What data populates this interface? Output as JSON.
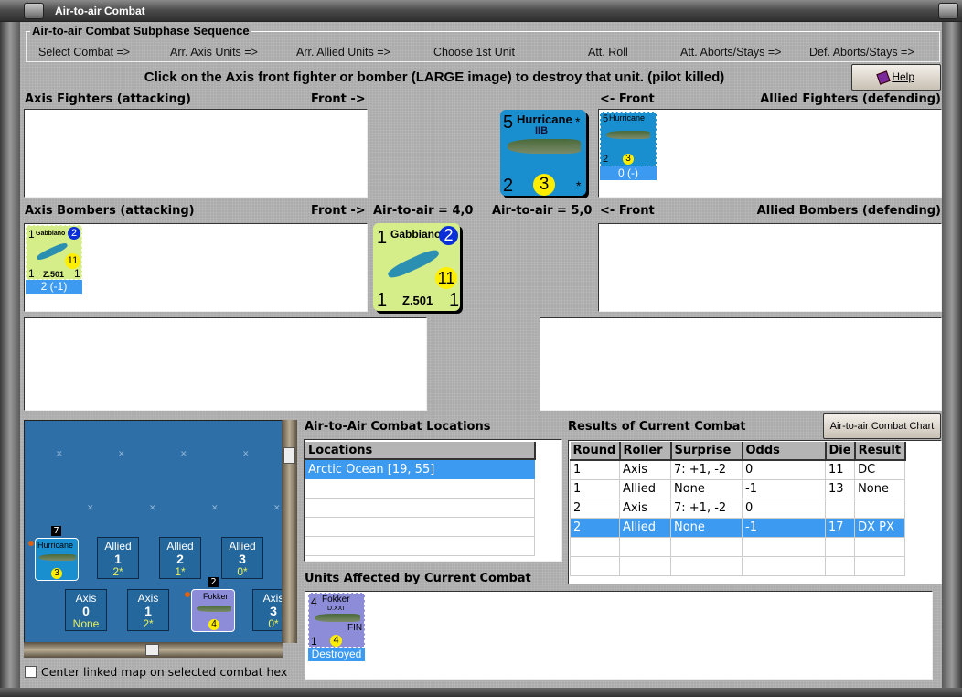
{
  "window": {
    "title": "Air-to-air Combat"
  },
  "subphase": {
    "title": "Air-to-air Combat Subphase Sequence",
    "steps": [
      "Select Combat =>",
      "Arr. Axis Units =>",
      "Arr. Allied Units =>",
      "Choose 1st Unit",
      "Att. Roll",
      "Att. Aborts/Stays =>",
      "Def. Aborts/Stays =>"
    ]
  },
  "instruction": "Click on the Axis front fighter or bomber (LARGE image) to destroy that unit. (pilot killed)",
  "help_label": "Help",
  "labels": {
    "axis_fighters": "Axis Fighters (attacking)",
    "front_right": "Front ->",
    "front_left": "<- Front",
    "allied_fighters": "Allied Fighters (defending)",
    "axis_bombers": "Axis Bombers (attacking)",
    "allied_bombers": "Allied Bombers (defending)",
    "axis_a2a": "Air-to-air = 4,0",
    "allied_a2a": "Air-to-air = 5,0"
  },
  "hurricane": {
    "name": "Hurricane",
    "model": "IIB",
    "top": "5",
    "bottom": "2",
    "range": "3",
    "star": "*",
    "status": "0 (-)"
  },
  "gabbiano": {
    "name": "Gabbiano",
    "model": "Z.501",
    "top": "1",
    "bottom_left": "1",
    "bottom_right": "1",
    "range": "11",
    "badge": "2",
    "status": "2 (-1)"
  },
  "fokker": {
    "name": "Fokker",
    "model": "D.XXI",
    "nation": "FIN",
    "top": "4",
    "bottom": "1",
    "range": "4",
    "star": "*",
    "status": "Destroyed"
  },
  "map": {
    "hurricane_stack": "7",
    "fokker_stack": "2",
    "allied_boxes": [
      {
        "side": "Allied",
        "n": "1",
        "v": "2*"
      },
      {
        "side": "Allied",
        "n": "2",
        "v": "1*"
      },
      {
        "side": "Allied",
        "n": "3",
        "v": "0*"
      }
    ],
    "axis_boxes": [
      {
        "side": "Axis",
        "n": "0",
        "v": "None"
      },
      {
        "side": "Axis",
        "n": "1",
        "v": "2*"
      },
      {
        "side": "Axis",
        "n": "3",
        "v": "0*"
      }
    ],
    "checkbox_label": "Center linked map on selected combat hex"
  },
  "locations": {
    "title": "Air-to-Air Combat Locations",
    "header": "Locations",
    "rows": [
      "Arctic Ocean [19, 55]"
    ]
  },
  "results": {
    "title": "Results of Current Combat",
    "chart_button": "Air-to-air Combat Chart",
    "headers": [
      "Round",
      "Roller",
      "Surprise",
      "Odds",
      "Die",
      "Result"
    ],
    "rows": [
      [
        "1",
        "Axis",
        "7: +1, -2",
        "0",
        "11",
        "DC"
      ],
      [
        "1",
        "Allied",
        "None",
        "-1",
        "13",
        "None"
      ],
      [
        "2",
        "Axis",
        "7: +1, -2",
        "0",
        "",
        ""
      ],
      [
        "2",
        "Allied",
        "None",
        "-1",
        "17",
        "DX PX"
      ]
    ]
  },
  "affected": {
    "title": "Units Affected by Current Combat"
  },
  "colors": {
    "selection": "#3c9af0",
    "allied_counter": "#1a8fd0",
    "italian_counter": "#d6ee8a",
    "finnish_counter": "#8c8cd8",
    "sea": "#2f6fa8"
  }
}
